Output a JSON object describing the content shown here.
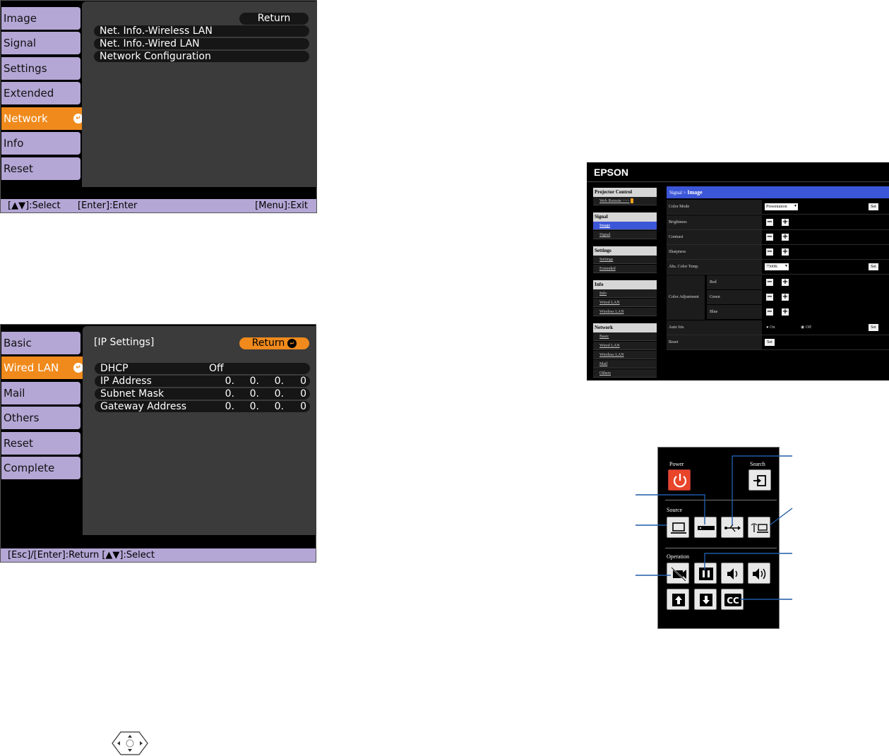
{
  "network_menu": {
    "tabs": [
      "Image",
      "Signal",
      "Settings",
      "Extended",
      "Network",
      "Info",
      "Reset"
    ],
    "active_tab": "Network",
    "return_label": "Return",
    "items": [
      "Net. Info.-Wireless LAN",
      "Net. Info.-Wired LAN",
      "Network Configuration"
    ],
    "footer": {
      "select": "[▲▼]:Select",
      "enter": "[Enter]:Enter",
      "exit": "[Menu]:Exit"
    }
  },
  "ip_menu": {
    "tabs": [
      "Basic",
      "Wired LAN",
      "Mail",
      "Others",
      "Reset",
      "Complete"
    ],
    "active_tab": "Wired LAN",
    "title": "[IP Settings]",
    "return_label": "Return",
    "dhcp": {
      "label": "DHCP",
      "value": "Off"
    },
    "rows": [
      {
        "label": "IP Address",
        "octets": [
          "0.",
          "0.",
          "0.",
          "0"
        ]
      },
      {
        "label": "Subnet Mask",
        "octets": [
          "0.",
          "0.",
          "0.",
          "0"
        ]
      },
      {
        "label": "Gateway Address",
        "octets": [
          "0.",
          "0.",
          "0.",
          "0"
        ]
      }
    ],
    "footer": "[Esc]/[Enter]:Return [▲▼]:Select"
  },
  "web_control": {
    "brand": "EPSON",
    "sidebar": [
      {
        "heading": "Projector Control",
        "items": [
          "Web Remote >>>"
        ]
      },
      {
        "heading": "Signal",
        "items": [
          "Image",
          "Signal"
        ]
      },
      {
        "heading": "Settings",
        "items": [
          "Settings",
          "Extended"
        ]
      },
      {
        "heading": "Info",
        "items": [
          "Info",
          "Wired LAN",
          "Wireless LAN"
        ]
      },
      {
        "heading": "Network",
        "items": [
          "Basic",
          "Wired LAN",
          "Wireless LAN",
          "Mail",
          "Others"
        ]
      }
    ],
    "active_item": "Image",
    "breadcrumb": "Signal >",
    "page_title": "Image",
    "rows": {
      "color_mode": {
        "label": "Color Mode",
        "value": "Presentation",
        "set": "Set"
      },
      "brightness": {
        "label": "Brightness"
      },
      "contrast": {
        "label": "Contrast"
      },
      "sharpness": {
        "label": "Sharpness"
      },
      "color_temp": {
        "label": "Abs. Color Temp.",
        "value": "7500K",
        "set": "Set"
      },
      "color_adjustment": {
        "label": "Color Adjustment",
        "sub": [
          "Red",
          "Green",
          "Blue"
        ]
      },
      "auto_iris": {
        "label": "Auto Iris",
        "on": "On",
        "off": "Off",
        "set": "Set"
      },
      "reset": {
        "label": "Reset",
        "set": "Set"
      }
    }
  },
  "web_remote": {
    "power": "Power",
    "search": "Search",
    "source": "Source",
    "operation": "Operation"
  },
  "colors": {
    "osd_tab": "#b4a6d5",
    "osd_active": "#f08a1c",
    "web_accent": "#3c56d8",
    "callout": "#1f5aa6"
  }
}
